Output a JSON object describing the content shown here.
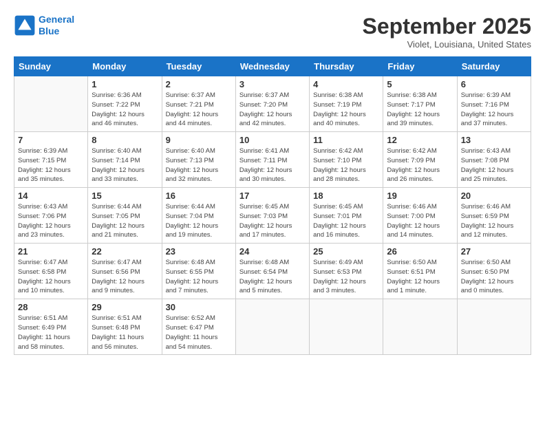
{
  "logo": {
    "line1": "General",
    "line2": "Blue"
  },
  "title": "September 2025",
  "subtitle": "Violet, Louisiana, United States",
  "days_header": [
    "Sunday",
    "Monday",
    "Tuesday",
    "Wednesday",
    "Thursday",
    "Friday",
    "Saturday"
  ],
  "weeks": [
    [
      {
        "num": "",
        "info": ""
      },
      {
        "num": "1",
        "info": "Sunrise: 6:36 AM\nSunset: 7:22 PM\nDaylight: 12 hours\nand 46 minutes."
      },
      {
        "num": "2",
        "info": "Sunrise: 6:37 AM\nSunset: 7:21 PM\nDaylight: 12 hours\nand 44 minutes."
      },
      {
        "num": "3",
        "info": "Sunrise: 6:37 AM\nSunset: 7:20 PM\nDaylight: 12 hours\nand 42 minutes."
      },
      {
        "num": "4",
        "info": "Sunrise: 6:38 AM\nSunset: 7:19 PM\nDaylight: 12 hours\nand 40 minutes."
      },
      {
        "num": "5",
        "info": "Sunrise: 6:38 AM\nSunset: 7:17 PM\nDaylight: 12 hours\nand 39 minutes."
      },
      {
        "num": "6",
        "info": "Sunrise: 6:39 AM\nSunset: 7:16 PM\nDaylight: 12 hours\nand 37 minutes."
      }
    ],
    [
      {
        "num": "7",
        "info": "Sunrise: 6:39 AM\nSunset: 7:15 PM\nDaylight: 12 hours\nand 35 minutes."
      },
      {
        "num": "8",
        "info": "Sunrise: 6:40 AM\nSunset: 7:14 PM\nDaylight: 12 hours\nand 33 minutes."
      },
      {
        "num": "9",
        "info": "Sunrise: 6:40 AM\nSunset: 7:13 PM\nDaylight: 12 hours\nand 32 minutes."
      },
      {
        "num": "10",
        "info": "Sunrise: 6:41 AM\nSunset: 7:11 PM\nDaylight: 12 hours\nand 30 minutes."
      },
      {
        "num": "11",
        "info": "Sunrise: 6:42 AM\nSunset: 7:10 PM\nDaylight: 12 hours\nand 28 minutes."
      },
      {
        "num": "12",
        "info": "Sunrise: 6:42 AM\nSunset: 7:09 PM\nDaylight: 12 hours\nand 26 minutes."
      },
      {
        "num": "13",
        "info": "Sunrise: 6:43 AM\nSunset: 7:08 PM\nDaylight: 12 hours\nand 25 minutes."
      }
    ],
    [
      {
        "num": "14",
        "info": "Sunrise: 6:43 AM\nSunset: 7:06 PM\nDaylight: 12 hours\nand 23 minutes."
      },
      {
        "num": "15",
        "info": "Sunrise: 6:44 AM\nSunset: 7:05 PM\nDaylight: 12 hours\nand 21 minutes."
      },
      {
        "num": "16",
        "info": "Sunrise: 6:44 AM\nSunset: 7:04 PM\nDaylight: 12 hours\nand 19 minutes."
      },
      {
        "num": "17",
        "info": "Sunrise: 6:45 AM\nSunset: 7:03 PM\nDaylight: 12 hours\nand 17 minutes."
      },
      {
        "num": "18",
        "info": "Sunrise: 6:45 AM\nSunset: 7:01 PM\nDaylight: 12 hours\nand 16 minutes."
      },
      {
        "num": "19",
        "info": "Sunrise: 6:46 AM\nSunset: 7:00 PM\nDaylight: 12 hours\nand 14 minutes."
      },
      {
        "num": "20",
        "info": "Sunrise: 6:46 AM\nSunset: 6:59 PM\nDaylight: 12 hours\nand 12 minutes."
      }
    ],
    [
      {
        "num": "21",
        "info": "Sunrise: 6:47 AM\nSunset: 6:58 PM\nDaylight: 12 hours\nand 10 minutes."
      },
      {
        "num": "22",
        "info": "Sunrise: 6:47 AM\nSunset: 6:56 PM\nDaylight: 12 hours\nand 9 minutes."
      },
      {
        "num": "23",
        "info": "Sunrise: 6:48 AM\nSunset: 6:55 PM\nDaylight: 12 hours\nand 7 minutes."
      },
      {
        "num": "24",
        "info": "Sunrise: 6:48 AM\nSunset: 6:54 PM\nDaylight: 12 hours\nand 5 minutes."
      },
      {
        "num": "25",
        "info": "Sunrise: 6:49 AM\nSunset: 6:53 PM\nDaylight: 12 hours\nand 3 minutes."
      },
      {
        "num": "26",
        "info": "Sunrise: 6:50 AM\nSunset: 6:51 PM\nDaylight: 12 hours\nand 1 minute."
      },
      {
        "num": "27",
        "info": "Sunrise: 6:50 AM\nSunset: 6:50 PM\nDaylight: 12 hours\nand 0 minutes."
      }
    ],
    [
      {
        "num": "28",
        "info": "Sunrise: 6:51 AM\nSunset: 6:49 PM\nDaylight: 11 hours\nand 58 minutes."
      },
      {
        "num": "29",
        "info": "Sunrise: 6:51 AM\nSunset: 6:48 PM\nDaylight: 11 hours\nand 56 minutes."
      },
      {
        "num": "30",
        "info": "Sunrise: 6:52 AM\nSunset: 6:47 PM\nDaylight: 11 hours\nand 54 minutes."
      },
      {
        "num": "",
        "info": ""
      },
      {
        "num": "",
        "info": ""
      },
      {
        "num": "",
        "info": ""
      },
      {
        "num": "",
        "info": ""
      }
    ]
  ]
}
